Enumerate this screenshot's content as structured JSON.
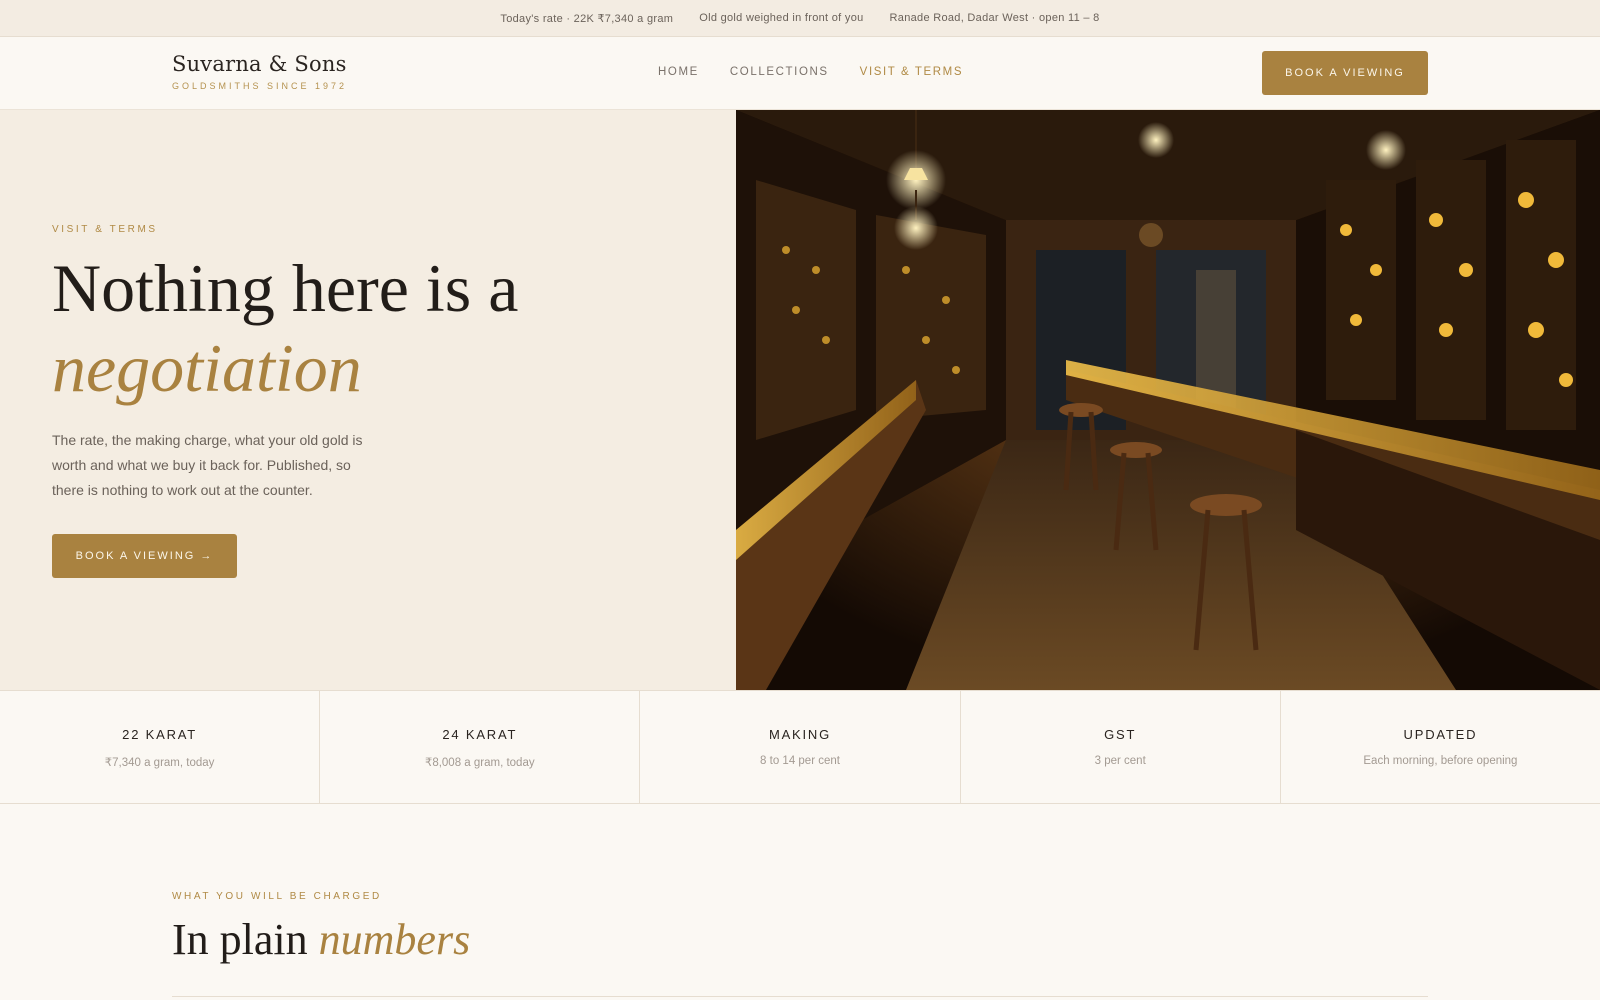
{
  "topbar": {
    "rate": "Today's rate · 22K ₹7,340 a gram",
    "weigh": "Old gold weighed in front of you",
    "address": "Ranade Road, Dadar West · open 11 – 8"
  },
  "brand": {
    "name": "Suvarna & Sons",
    "tagline": "GOLDSMITHS SINCE 1972"
  },
  "nav": {
    "items": [
      {
        "label": "HOME"
      },
      {
        "label": "COLLECTIONS"
      },
      {
        "label": "VISIT & TERMS"
      }
    ],
    "active": "VISIT & TERMS"
  },
  "header": {
    "cta_label": "BOOK A VIEWING"
  },
  "hero": {
    "eyebrow": "VISIT & TERMS",
    "title_line1": "Nothing here is a",
    "title_accent": "negotiation",
    "description": "The rate, the making charge, what your old gold is worth and what we buy it back for. Published, so there is nothing to work out at the counter.",
    "cta_label": "BOOK A VIEWING →"
  },
  "stats": [
    {
      "label": "22 KARAT",
      "value": "₹7,340 a gram, today"
    },
    {
      "label": "24 KARAT",
      "value": "₹8,008 a gram, today"
    },
    {
      "label": "MAKING",
      "value": "8 to 14 per cent"
    },
    {
      "label": "GST",
      "value": "3 per cent"
    },
    {
      "label": "UPDATED",
      "value": "Each morning, before opening"
    }
  ],
  "charges": {
    "eyebrow": "WHAT YOU WILL BE CHARGED",
    "title_plain": "In plain",
    "title_accent": "numbers"
  },
  "colors": {
    "accent": "#a98240",
    "background": "#fbf8f3",
    "hero_background": "#f4ede2",
    "text": "#2a2420"
  }
}
